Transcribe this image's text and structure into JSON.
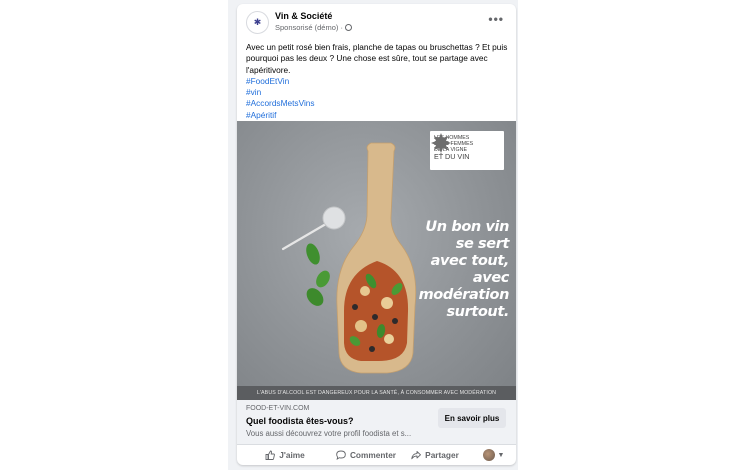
{
  "post": {
    "page_name": "Vin & Société",
    "sponsored_label": "Sponsorisé (démo) ·",
    "body_text": "Avec un petit rosé bien frais, planche de tapas ou bruschettas ? Et puis pourquoi pas les deux ? Une chose est sûre, tout se partage avec l'apéritivore.",
    "hashtags": [
      "#FoodEtVin",
      "#vin",
      "#AccordsMetsVins",
      "#Apéritif"
    ]
  },
  "ad_image": {
    "logo_lines": [
      "LES HOMMES",
      "& LES FEMMES",
      "DE LA VIGNE",
      "ET DU VIN"
    ],
    "slogan_lines": [
      "Un bon vin",
      "se sert",
      "avec tout,",
      "avec",
      "modération",
      "surtout."
    ],
    "warning": "L'ABUS D'ALCOOL EST DANGEREUX POUR LA SANTÉ, À CONSOMMER AVEC MODÉRATION"
  },
  "link_preview": {
    "domain": "FOOD-ET-VIN.COM",
    "title": "Quel foodista êtes-vous?",
    "description": "Vous aussi découvrez votre profil foodista et s...",
    "cta_label": "En savoir plus"
  },
  "actions": {
    "like": "J'aime",
    "comment": "Commenter",
    "share": "Partager"
  },
  "icons": {
    "globe": "globe-icon",
    "more": "more-options-icon",
    "like": "thumbs-up-icon",
    "comment": "comment-bubble-icon",
    "share": "share-arrow-icon",
    "leaf": "vine-leaf-icon"
  },
  "colors": {
    "hashtag": "#216fdb",
    "secondary_text": "#65676b",
    "card_bg": "#ffffff",
    "feed_bg": "#f0f2f5"
  }
}
